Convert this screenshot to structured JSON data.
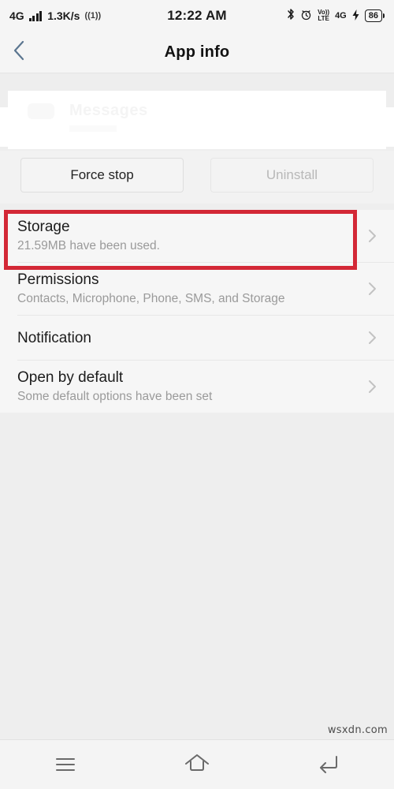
{
  "status_bar": {
    "network_type": "4G",
    "signal_icon": "signal-bars-icon",
    "data_speed": "1.3K/s",
    "hotspot_icon": "hotspot-icon",
    "time": "12:22 AM",
    "bluetooth_icon": "bluetooth-icon",
    "alarm_icon": "alarm-clock-icon",
    "volte_top": "Vo))",
    "volte_bottom": "LTE",
    "second_network_type": "4G",
    "charging_icon": "charging-bolt-icon",
    "battery_level": "86"
  },
  "app_bar": {
    "back_icon": "back-chevron-icon",
    "title": "App info"
  },
  "app_header": {
    "app_name_redacted": "Messages",
    "note": "app icon and name are covered by white redaction"
  },
  "actions": {
    "force_stop_label": "Force stop",
    "uninstall_label": "Uninstall",
    "uninstall_disabled": true
  },
  "settings_rows": [
    {
      "title": "Storage",
      "subtitle": "21.59MB have been used.",
      "chevron": "chevron-right-icon",
      "highlighted": true
    },
    {
      "title": "Permissions",
      "subtitle": "Contacts, Microphone, Phone, SMS, and Storage",
      "chevron": "chevron-right-icon",
      "highlighted": false
    },
    {
      "title": "Notification",
      "subtitle": "",
      "chevron": "chevron-right-icon",
      "highlighted": false
    },
    {
      "title": "Open by default",
      "subtitle": "Some default options have been set",
      "chevron": "chevron-right-icon",
      "highlighted": false
    }
  ],
  "annotation": {
    "color": "#d32836",
    "target": "Storage"
  },
  "nav_bar": {
    "recents_icon": "menu-recents-icon",
    "home_icon": "home-icon",
    "back_icon": "back-arrow-icon"
  },
  "watermark": {
    "text": "wsxdn.com"
  }
}
